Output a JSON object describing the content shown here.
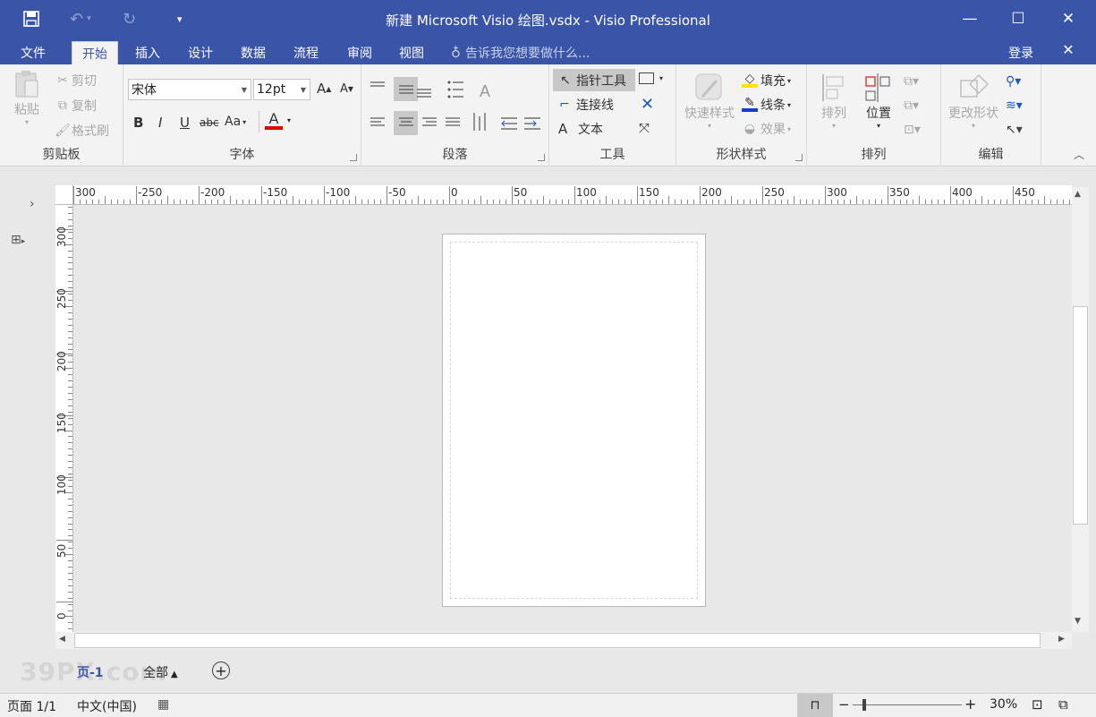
{
  "title": "新建 Microsoft Visio 绘图.vsdx - Visio Professional",
  "tabs": [
    "文件",
    "开始",
    "插入",
    "设计",
    "数据",
    "流程",
    "审阅",
    "视图"
  ],
  "tell_me": "告诉我您想要做什么...",
  "signin": "登录",
  "clipboard": {
    "label": "剪贴板",
    "paste": "粘贴",
    "cut": "剪切",
    "copy": "复制",
    "format_painter": "格式刷"
  },
  "font": {
    "label": "字体",
    "name": "宋体",
    "size": "12pt",
    "bold": "B",
    "italic": "I",
    "underline": "U",
    "strike": "abc",
    "case": "Aa",
    "color_glyph": "A",
    "grow": "A",
    "shrink": "A"
  },
  "paragraph": {
    "label": "段落"
  },
  "tools": {
    "label": "工具",
    "pointer": "指针工具",
    "connector": "连接线",
    "text_glyph": "A",
    "text": "文本"
  },
  "shape_styles": {
    "label": "形状样式",
    "quick": "快速样式",
    "fill": "填充",
    "line": "线条",
    "effects": "效果"
  },
  "arrange": {
    "label": "排列",
    "arrange_btn": "排列",
    "position": "位置"
  },
  "editing": {
    "label": "编辑",
    "change_shape": "更改形状"
  },
  "ruler": {
    "h_labels": [
      "300",
      "-250",
      "-200",
      "-150",
      "-100",
      "-50",
      "0",
      "50",
      "100",
      "150",
      "200",
      "250",
      "300",
      "350",
      "400",
      "450"
    ],
    "v_labels": [
      "300",
      "250",
      "200",
      "150",
      "100",
      "50",
      "0"
    ]
  },
  "page_tabs": {
    "page": "页-1",
    "all": "全部"
  },
  "status": {
    "page": "页面 1/1",
    "lang": "中文(中国)",
    "zoom": "30%"
  },
  "watermark": "39PX.com",
  "colors": {
    "accent": "#3a55a7",
    "fill_swatch": "#ffe600",
    "line_swatch": "#1a3ad1",
    "font_color": "#e00000"
  }
}
